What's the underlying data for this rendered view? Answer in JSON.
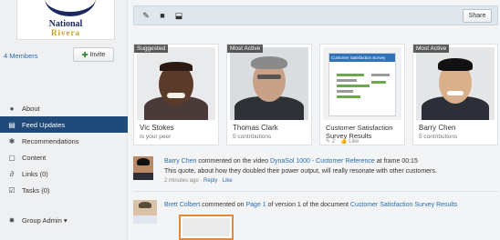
{
  "logo": {
    "line1": "National",
    "line2": "Rivera"
  },
  "members": "4 Members",
  "invite_label": "Invite",
  "nav": [
    {
      "label": "About",
      "icon": "info-icon"
    },
    {
      "label": "Feed Updates",
      "icon": "feed-icon",
      "active": true
    },
    {
      "label": "Recommendations",
      "icon": "star-icon"
    },
    {
      "label": "Content",
      "icon": "document-icon"
    },
    {
      "label": "Links (0)",
      "icon": "link-icon"
    },
    {
      "label": "Tasks (0)",
      "icon": "checkbox-icon"
    }
  ],
  "admin_label": "Group Admin ▾",
  "toolbar": {
    "share_label": "Share"
  },
  "cards": [
    {
      "tag": "Suggested",
      "name": "Vic Stokes",
      "sub": "Is your peer"
    },
    {
      "tag": "Most Active",
      "name": "Thomas Clark",
      "sub": "5 contributions"
    },
    {
      "tag": "",
      "name": "Customer Satisfaction Survey Results",
      "sub": "",
      "doc_title": "Customer Satisfaction Survey",
      "comments": "2",
      "likes": "Like"
    },
    {
      "tag": "Most Active",
      "name": "Barry Chen",
      "sub": "5 contributions"
    }
  ],
  "feed": [
    {
      "author": "Barry Chen",
      "action": " commented on the video ",
      "target": "DynaSol 1000 - Customer Reference",
      "suffix": " at frame 00:15",
      "body": "This quote, about how they doubled their power output, will really resonate with other customers.",
      "time": "2 minutes ago",
      "reply": "Reply",
      "like": "Like"
    },
    {
      "author": "Brett Colbert",
      "action": " commented on ",
      "target": "Page 1",
      "suffix": " of version 1 of the document ",
      "target2": "Customer Satisfaction Survey Results"
    }
  ],
  "colors": {
    "nav_active": "#1f4a7a",
    "link": "#2b6cb0",
    "accent": "#e08a3a"
  }
}
